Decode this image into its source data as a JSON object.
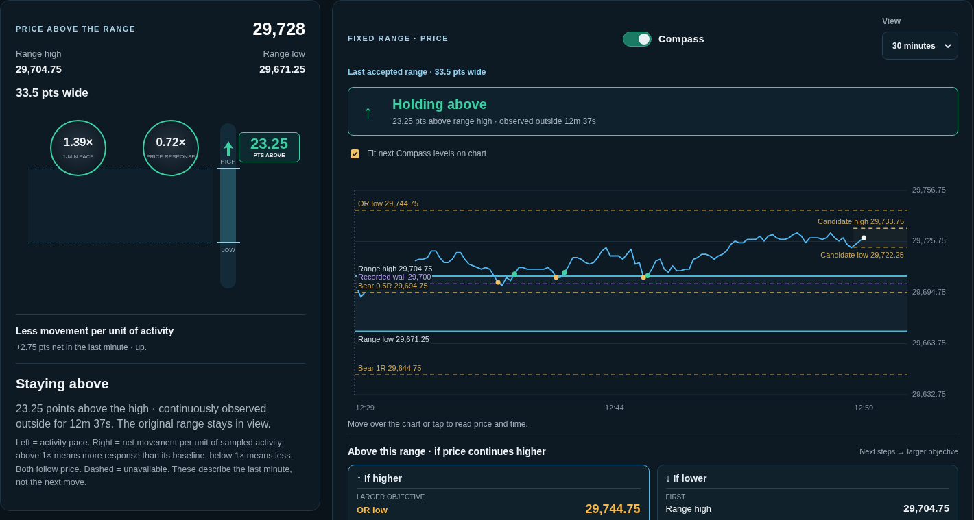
{
  "summary": {
    "title": "PRICE ABOVE THE RANGE",
    "price": "29,728",
    "range_high_label": "Range high",
    "range_high": "29,704.75",
    "range_low_label": "Range low",
    "range_low": "29,671.25",
    "width": "33.5 pts wide"
  },
  "gauges": [
    {
      "value": "1.39×",
      "label": "1-MIN PACE"
    },
    {
      "value": "0.72×",
      "label": "PRICE RESPONSE"
    }
  ],
  "range_bar": {
    "high_label": "HIGH",
    "low_label": "LOW"
  },
  "distance_badge": {
    "value": "23.25",
    "label": "PTS ABOVE"
  },
  "activity": {
    "title": "Less movement per unit of activity",
    "detail": "+2.75 pts net in the last minute · up."
  },
  "state": {
    "title": "Staying above",
    "description": "23.25 points above the high · continuously observed outside for 12m 37s. The original range stays in view.",
    "note": "Left = activity pace. Right = net movement per unit of sampled activity: above 1× means more response than its baseline, below 1× means less. Both follow price. Dashed = unavailable. These describe the last minute, not the next move."
  },
  "header": {
    "title": "FIXED RANGE · PRICE",
    "compass_toggle": {
      "label": "Compass",
      "on": true
    },
    "view": {
      "label": "View",
      "value": "30 minutes"
    }
  },
  "range_caption": "Last accepted range · 33.5 pts wide",
  "status": {
    "arrow": "↑",
    "title": "Holding above",
    "detail": "23.25 pts above range high · observed outside 12m 37s"
  },
  "fit_levels": {
    "label": "Fit next Compass levels on chart",
    "checked": true
  },
  "chart": {
    "chart_data": {
      "type": "line",
      "categories": [
        null,
        null,
        "12:29",
        null,
        null,
        null,
        null,
        null,
        null,
        null,
        null,
        null,
        null,
        null,
        null,
        null,
        null,
        null,
        null,
        null,
        null,
        null,
        null,
        null,
        null,
        null,
        null,
        null,
        null,
        null,
        null,
        null,
        null,
        null,
        null,
        null,
        null,
        null,
        null,
        null,
        null,
        null,
        null,
        null,
        null,
        null,
        null,
        null,
        null,
        null,
        null,
        null,
        null,
        null,
        null,
        null,
        null,
        null,
        null,
        null,
        null,
        null,
        "12:44",
        null,
        null,
        null,
        null,
        null,
        null,
        null,
        null,
        null,
        null,
        null,
        null,
        null,
        null,
        null,
        null,
        null,
        null,
        null,
        null,
        null,
        null,
        null,
        null,
        null,
        null,
        null,
        null,
        null,
        null,
        null,
        null,
        null,
        null,
        null,
        null,
        null,
        null,
        null,
        null,
        null,
        null,
        null,
        null,
        null,
        null,
        null,
        null,
        null,
        null,
        null,
        null,
        null,
        null,
        null,
        null,
        null,
        null,
        null,
        "12:59",
        null,
        null,
        null,
        null,
        null,
        null,
        null,
        null,
        null,
        null
      ],
      "series": [
        {
          "color": "#52b9f2",
          "values": [
            29698,
            29692,
            29695,
            null,
            null,
            null,
            null,
            null,
            null,
            null,
            null,
            null,
            null,
            null,
            29714,
            29715,
            29715,
            29716,
            29720,
            29720,
            29716,
            29713,
            29713,
            29715,
            29719,
            29719,
            29715,
            29712,
            29711,
            29710,
            29709,
            29710,
            29709,
            29705,
            29701,
            29699,
            29704,
            29702,
            29706,
            29710,
            29710,
            29709,
            29709,
            29709,
            29709,
            29709,
            29710,
            29708,
            29704,
            29704,
            29707,
            29711,
            29716,
            29716,
            29715,
            29713,
            29712,
            29713,
            29716,
            29720,
            29722,
            29717,
            29717,
            29717,
            29715,
            29718,
            29721,
            29712,
            29713,
            29704,
            29705,
            29709,
            29714,
            29715,
            29709,
            29707,
            29711,
            29708,
            29708,
            29709,
            29709,
            29715,
            29716,
            29718,
            29718,
            29717,
            29715,
            29717,
            29718,
            29720,
            29724,
            29726,
            29725,
            29725,
            29727,
            29727,
            29727,
            29729,
            29726,
            29729,
            29730,
            29728,
            29727,
            29727,
            29728,
            29730,
            29731,
            29729,
            29725,
            29728,
            29728,
            29728,
            29727,
            29728,
            29731,
            29728,
            29726,
            29728,
            29724,
            29722,
            29724,
            29726,
            29728,
            null,
            null,
            null,
            null,
            null,
            null,
            null,
            null,
            null,
            null
          ]
        }
      ],
      "ylim": [
        29632.75,
        29756.75
      ],
      "yticks": [
        {
          "value": 29756.75,
          "label": "29,756.75"
        },
        {
          "value": 29725.75,
          "label": "29,725.75"
        },
        {
          "value": 29694.75,
          "label": "29,694.75"
        },
        {
          "value": 29663.75,
          "label": "29,663.75"
        },
        {
          "value": 29632.75,
          "label": "29,632.75"
        }
      ],
      "bands": [
        {
          "axis": "y",
          "from": 29671.25,
          "to": 29704.75,
          "color": "#12232f"
        },
        {
          "axis": "y",
          "from": 29722.25,
          "to": 29733.75,
          "color": "#172128"
        }
      ],
      "ref_lines": [
        {
          "axis": "y",
          "value": 29744.75,
          "label": "OR low 29,744.75",
          "color": "#d4aa55"
        },
        {
          "axis": "y",
          "value": 29733.75,
          "label": "Candidate high 29,733.75",
          "color": "#d4aa55"
        },
        {
          "axis": "y",
          "value": 29722.25,
          "label": "Candidate low 29,722.25",
          "color": "#d4aa55"
        },
        {
          "axis": "y",
          "value": 29704.75,
          "label": "Range high 29,704.75",
          "color": "#4bb6d6"
        },
        {
          "axis": "y",
          "value": 29700,
          "label": "Recorded wall 29,700",
          "color": "#b7a5f2"
        },
        {
          "axis": "y",
          "value": 29694.75,
          "label": "Bear 0.5R 29,694.75",
          "color": "#d4aa55"
        },
        {
          "axis": "y",
          "value": 29671.25,
          "label": "Range low 29,671.25",
          "color": "#4bb6d6"
        },
        {
          "axis": "y",
          "value": 29644.75,
          "label": "Bear 1R 29,644.75",
          "color": "#d4aa55"
        }
      ]
    },
    "hint": "Move over the chart or tap to read price and time."
  },
  "scenarios": {
    "title": "Above this range · if price continues higher",
    "hint": "Next steps → larger objective",
    "cards": [
      {
        "title": "↑ If higher",
        "selected": true,
        "rows": [
          {
            "caption": "LARGER OBJECTIVE",
            "name": "OR low",
            "value": "29,744.75",
            "kind": "objective"
          }
        ]
      },
      {
        "title": "↓ If lower",
        "selected": false,
        "rows": [
          {
            "caption": "FIRST",
            "name": "Range high",
            "value": "29,704.75",
            "kind": "level"
          }
        ]
      }
    ]
  }
}
